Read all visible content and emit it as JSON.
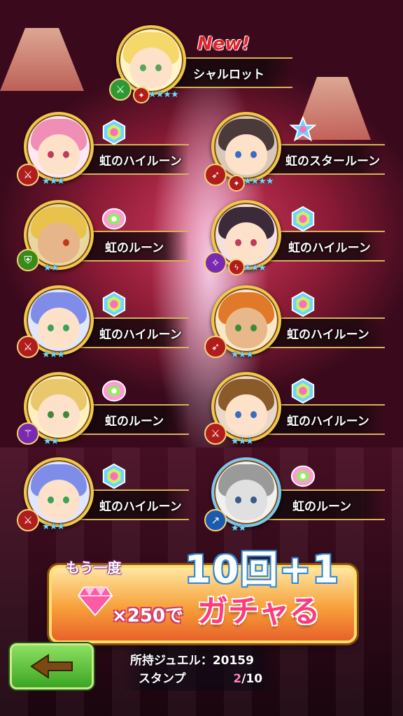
{
  "header": {
    "new_label": "New!"
  },
  "featured": {
    "name": "シャルロット",
    "rarity": "★★★★"
  },
  "results": [
    {
      "item": "虹のハイルーン",
      "rarity": "★★★",
      "weapon": "sword"
    },
    {
      "item": "虹のスタールーン",
      "rarity": "★★★★",
      "weapon": "bow"
    },
    {
      "item": "虹のルーン",
      "rarity": "★★",
      "weapon": "shield"
    },
    {
      "item": "虹のハイルーン",
      "rarity": "★★★",
      "weapon": "magic"
    },
    {
      "item": "虹のハイルーン",
      "rarity": "★★★",
      "weapon": "sword"
    },
    {
      "item": "虹のハイルーン",
      "rarity": "★★★",
      "weapon": "bow"
    },
    {
      "item": "虹のルーン",
      "rarity": "★★",
      "weapon": "staff"
    },
    {
      "item": "虹のハイルーン",
      "rarity": "★★★",
      "weapon": "sword"
    },
    {
      "item": "虹のハイルーン",
      "rarity": "★★★",
      "weapon": "sword"
    },
    {
      "item": "虹のルーン",
      "rarity": "★★",
      "weapon": "spear"
    }
  ],
  "gacha_button": {
    "prefix": "もう一度",
    "count_label": "10回+1",
    "cost": "×250で",
    "action": "ガチャる"
  },
  "status": {
    "jewel_label": "所持ジュエル：",
    "jewel_value": "20159",
    "stamp_label": "スタンプ",
    "stamp_current": "2",
    "stamp_max": "/10"
  },
  "colors": {
    "gold": "#f1c84a",
    "star": "#79d6f5",
    "accent_pink": "#ff3a7a",
    "back_green": "#3aa623"
  }
}
